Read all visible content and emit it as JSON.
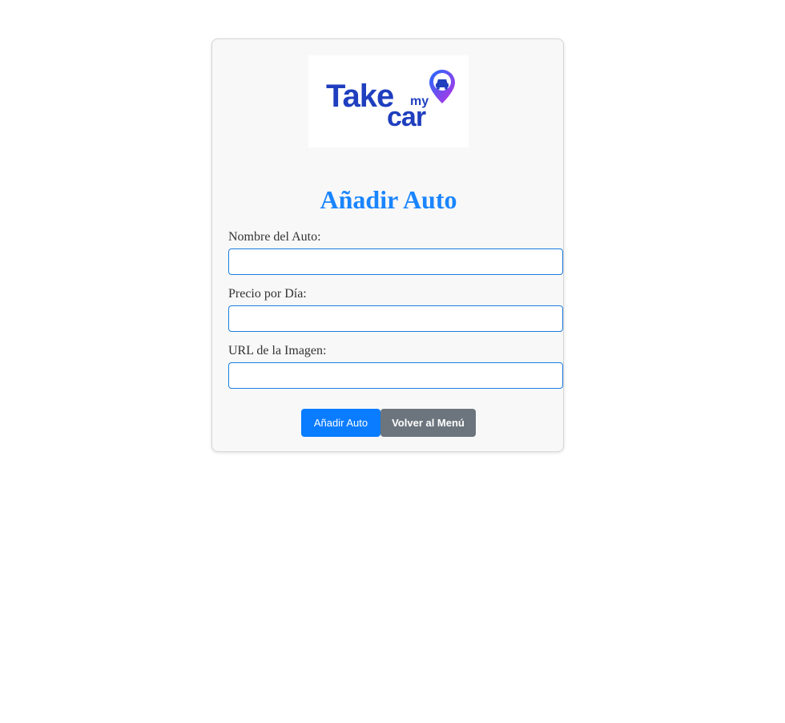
{
  "logo": {
    "word_take": "Take",
    "word_my": "my",
    "word_car": "car",
    "icon": "car-location-pin-icon",
    "colors": {
      "text": "#1f3fbf",
      "pin_start": "#1e6bff",
      "pin_end": "#c030e0"
    }
  },
  "form": {
    "title": "Añadir Auto",
    "fields": [
      {
        "label": "Nombre del Auto:",
        "value": "",
        "placeholder": ""
      },
      {
        "label": "Precio por Día:",
        "value": "",
        "placeholder": ""
      },
      {
        "label": "URL de la Imagen:",
        "value": "",
        "placeholder": ""
      }
    ],
    "submit_label": "Añadir Auto",
    "back_label": "Volver al Menú"
  },
  "colors": {
    "accent": "#1a85ff",
    "primary_button": "#0a7cff",
    "secondary_button": "#6c757d",
    "input_border": "#1a7ee0",
    "card_background": "#f8f8f8"
  }
}
